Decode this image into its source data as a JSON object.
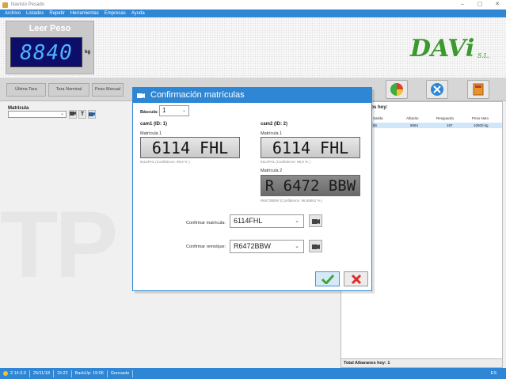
{
  "window": {
    "title": "Navisto Pesado",
    "controls": [
      "–",
      "▢",
      "✕"
    ]
  },
  "menu": [
    "Archivo",
    "Listados",
    "Repetir",
    "Herramientas",
    "Empresas",
    "Ayuda"
  ],
  "weigh": {
    "title": "Leer Peso",
    "value": "8840",
    "unit": "kg"
  },
  "logo": {
    "text": "DAVi",
    "suffix": "S.L."
  },
  "toolbar": {
    "ultima_tara": "Última Tara",
    "tara_nominal": "Tara Nominal",
    "peso_manual": "Peso Manual"
  },
  "left": {
    "matricula_label": "Matrícula",
    "icon_t": "T",
    "watermark": "TP"
  },
  "right": {
    "title": "nes realizados hoy:",
    "columns": [
      "Salida",
      "Albarán",
      "Resguardo",
      "Peso Neto"
    ],
    "row": [
      "55",
      "9084",
      "197",
      "10500 kg"
    ],
    "footer": "Total Albaranes hoy: 1"
  },
  "status": {
    "version": "2.14.0.0",
    "date": "25/11/18",
    "time": "15:22",
    "backup": "BackUp: 19:06",
    "server": "Gonvasto",
    "right": "ES"
  },
  "dialog": {
    "title": "Confirmación matrículas",
    "bascula_label": "Báscula:",
    "bascula_value": "1",
    "cam1": {
      "title": "cam1 (ID: 1)",
      "plate_label": "Matrícula 1",
      "plate": "6114 FHL",
      "confidence": "6114FHL (Confidence: 99,9 % )"
    },
    "cam2": {
      "title": "cam2 (ID: 2)",
      "plate1_label": "Matrícula 1",
      "plate1": "6114 FHL",
      "confidence1": "6114FHL (Confidence: 99,9 % )",
      "plate2_label": "Matrícula 2",
      "plate2": "R 6472 BBW",
      "confidence2": "R6472BBW (Confidence: 96,98561 % )"
    },
    "confirm_matricula_label": "Confirmar matrícula:",
    "confirm_matricula_value": "6114FHL",
    "confirm_remolque_label": "Confirmar remolque:",
    "confirm_remolque_value": "R6472BBW"
  },
  "colors": {
    "accent": "#2f86d4",
    "display_bg": "#0d0d6a",
    "display_fg": "#4fb3ff",
    "logo": "#3b9a2e"
  }
}
